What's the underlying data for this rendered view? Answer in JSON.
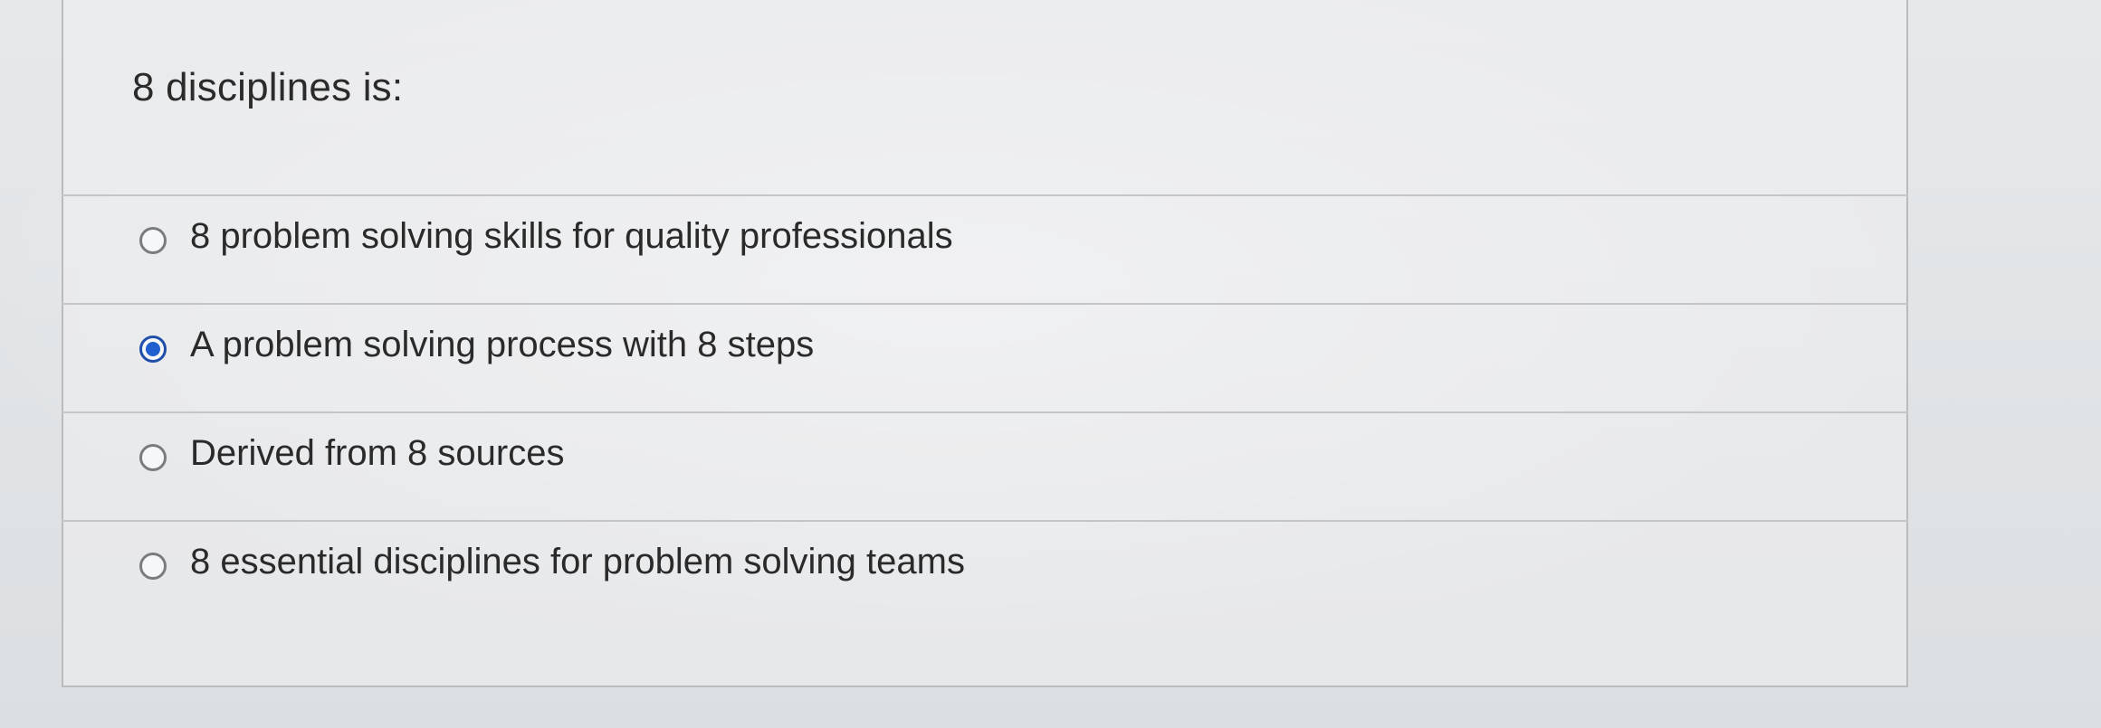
{
  "question": {
    "text": "8 disciplines is:"
  },
  "answers": [
    {
      "label": "8 problem solving skills for quality professionals",
      "selected": false
    },
    {
      "label": "A problem solving process with 8 steps",
      "selected": true
    },
    {
      "label": "Derived from 8 sources",
      "selected": false
    },
    {
      "label": "8 essential disciplines for problem solving teams",
      "selected": false
    }
  ],
  "colors": {
    "radio_selected": "#1f5fd0",
    "radio_border": "#7a7d80",
    "text": "#2a2a2a"
  }
}
